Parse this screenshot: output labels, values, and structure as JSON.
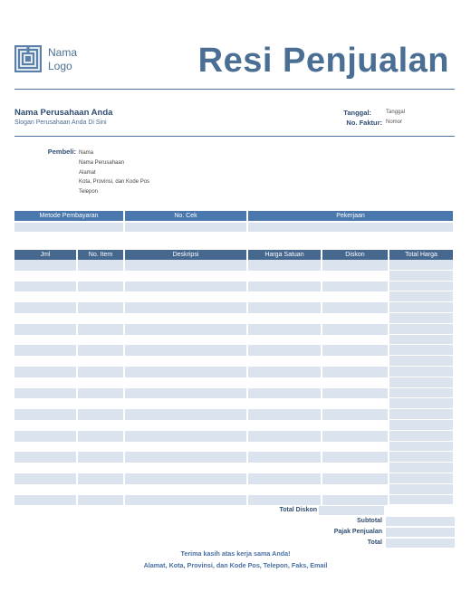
{
  "logo": {
    "icon": "logo-icon",
    "text": "Nama\nLogo"
  },
  "title": "Resi Penjualan",
  "company": {
    "name": "Nama Perusahaan Anda",
    "slogan": "Slogan Perusahaan Anda Di Sini"
  },
  "meta": {
    "date_label": "Tanggal:",
    "date_value": "Tanggal",
    "invoice_label": "No. Faktur:",
    "invoice_value": "Nomor"
  },
  "buyer": {
    "label": "Pembeli:",
    "lines": [
      "Nama",
      "Nama Perusahaan",
      "Alamat",
      "Kota, Provinsi, dan Kode Pos",
      "Telepon"
    ]
  },
  "payment_table": {
    "headers": [
      "Metode Pembayaran",
      "No. Cek",
      "Pekerjaan"
    ]
  },
  "items_table": {
    "headers": [
      "Jml",
      "No. Item",
      "Deskripsi",
      "Harga Satuan",
      "Diskon",
      "Total Harga"
    ]
  },
  "summary": {
    "total_discount": "Total Diskon",
    "subtotal": "Subtotal",
    "sales_tax": "Pajak Penjualan",
    "total": "Total"
  },
  "footer": {
    "thanks": "Terima kasih atas kerja sama Anda!",
    "address": "Alamat, Kota, Provinsi, dan Kode Pos, Telepon, Faks, Email"
  },
  "colors": {
    "accent": "#4a77ac",
    "header_dark": "#46678e",
    "cell": "#dbe3ee",
    "title": "#4a6e94"
  }
}
